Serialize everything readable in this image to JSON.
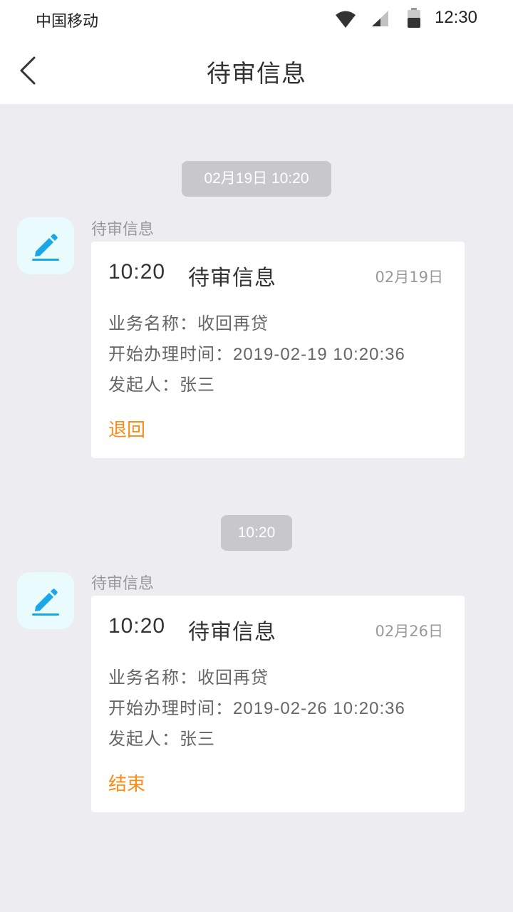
{
  "status_bar": {
    "carrier": "中国移动",
    "time": "12:30",
    "icons": [
      "wifi-icon",
      "signal-icon",
      "battery-icon"
    ]
  },
  "nav": {
    "back_icon": "chevron-left-icon",
    "title": "待审信息"
  },
  "messages": [
    {
      "timestamp": "02月19日 10:20",
      "avatar_icon": "pencil-icon",
      "sender": "待审信息",
      "card": {
        "time": "10:20",
        "title": "待审信息",
        "date": "02月19日",
        "business_label": "业务名称：",
        "business_value": "收回再贷",
        "start_label": "开始办理时间：",
        "start_value": "2019-02-19 10:20:36",
        "initiator_label": "发起人：",
        "initiator_value": "张三",
        "action": "退回"
      }
    },
    {
      "timestamp": "10:20",
      "avatar_icon": "pencil-icon",
      "sender": "待审信息",
      "card": {
        "time": "10:20",
        "title": "待审信息",
        "date": "02月26日",
        "business_label": "业务名称：",
        "business_value": "收回再贷",
        "start_label": "开始办理时间：",
        "start_value": "2019-02-26 10:20:36",
        "initiator_label": "发起人：",
        "initiator_value": "张三",
        "action": "结束"
      }
    }
  ],
  "colors": {
    "background": "#ececf1",
    "timestamp_bg": "#c8c8cc",
    "avatar_bg": "#e9fbfd",
    "icon_blue": "#1aa7e8",
    "text_dark": "#333333",
    "text_mid": "#666666",
    "text_light": "#999999",
    "action_orange": "#fe8a14"
  }
}
